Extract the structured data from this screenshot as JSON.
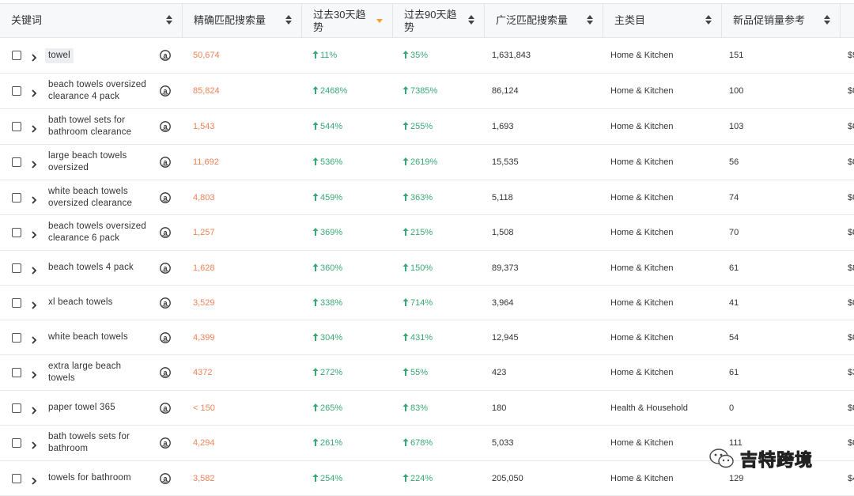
{
  "headers": {
    "keyword": "关键词",
    "exact": "精确匹配搜索量",
    "t30_line1": "过去30天趋",
    "t30_line2": "势",
    "t90_line1": "过去90天趋",
    "t90_line2": "势",
    "broad": "广泛匹配搜索量",
    "category": "主类目",
    "newprod": "新品促销量参考"
  },
  "rows": [
    {
      "kw1": "towel",
      "kw2": "",
      "exact": "50,674",
      "t30": "11%",
      "t90": "35%",
      "broad": "1,631,843",
      "cat": "Home & Kitchen",
      "np": "151",
      "last": "$9"
    },
    {
      "kw1": "beach towels oversized",
      "kw2": "clearance 4 pack",
      "exact": "85,824",
      "t30": "2468%",
      "t90": "7385%",
      "broad": "86,124",
      "cat": "Home & Kitchen",
      "np": "100",
      "last": "$0"
    },
    {
      "kw1": "bath towel sets for",
      "kw2": "bathroom clearance",
      "exact": "1,543",
      "t30": "544%",
      "t90": "255%",
      "broad": "1,693",
      "cat": "Home & Kitchen",
      "np": "103",
      "last": "$0"
    },
    {
      "kw1": "large beach towels",
      "kw2": "oversized",
      "exact": "11,692",
      "t30": "536%",
      "t90": "2619%",
      "broad": "15,535",
      "cat": "Home & Kitchen",
      "np": "56",
      "last": "$0"
    },
    {
      "kw1": "white beach towels",
      "kw2": "oversized clearance",
      "exact": "4,803",
      "t30": "459%",
      "t90": "363%",
      "broad": "5,118",
      "cat": "Home & Kitchen",
      "np": "74",
      "last": "$0"
    },
    {
      "kw1": "beach towels oversized",
      "kw2": "clearance 6 pack",
      "exact": "1,257",
      "t30": "369%",
      "t90": "215%",
      "broad": "1,508",
      "cat": "Home & Kitchen",
      "np": "70",
      "last": "$0"
    },
    {
      "kw1": "beach towels 4 pack",
      "kw2": "",
      "exact": "1,628",
      "t30": "360%",
      "t90": "150%",
      "broad": "89,373",
      "cat": "Home & Kitchen",
      "np": "61",
      "last": "$8"
    },
    {
      "kw1": "xl beach towels",
      "kw2": "",
      "exact": "3,529",
      "t30": "338%",
      "t90": "714%",
      "broad": "3,964",
      "cat": "Home & Kitchen",
      "np": "41",
      "last": "$0"
    },
    {
      "kw1": "white beach towels",
      "kw2": "",
      "exact": "4,399",
      "t30": "304%",
      "t90": "431%",
      "broad": "12,945",
      "cat": "Home & Kitchen",
      "np": "54",
      "last": "$0"
    },
    {
      "kw1": "extra large beach",
      "kw2": "towels",
      "exact": "4372",
      "t30": "272%",
      "t90": "55%",
      "broad": "423",
      "cat": "Home & Kitchen",
      "np": "61",
      "last": "$3"
    },
    {
      "kw1": "paper towel 365",
      "kw2": "",
      "exact": "< 150",
      "t30": "265%",
      "t90": "83%",
      "broad": "180",
      "cat": "Health & Household",
      "np": "0",
      "last": "$0"
    },
    {
      "kw1": "bath towels sets for",
      "kw2": "bathroom",
      "exact": "4,294",
      "t30": "261%",
      "t90": "678%",
      "broad": "5,033",
      "cat": "Home & Kitchen",
      "np": "111",
      "last": "$0"
    },
    {
      "kw1": "towels for bathroom",
      "kw2": "",
      "exact": "3,582",
      "t30": "254%",
      "t90": "224%",
      "broad": "205,050",
      "cat": "Home & Kitchen",
      "np": "129",
      "last": "$4"
    }
  ],
  "watermark": "吉特跨境",
  "colors": {
    "exact": "#f08358",
    "trend_up": "#3aa876",
    "header_bg": "#f7f8fa",
    "sort_active": "#f0a030"
  }
}
